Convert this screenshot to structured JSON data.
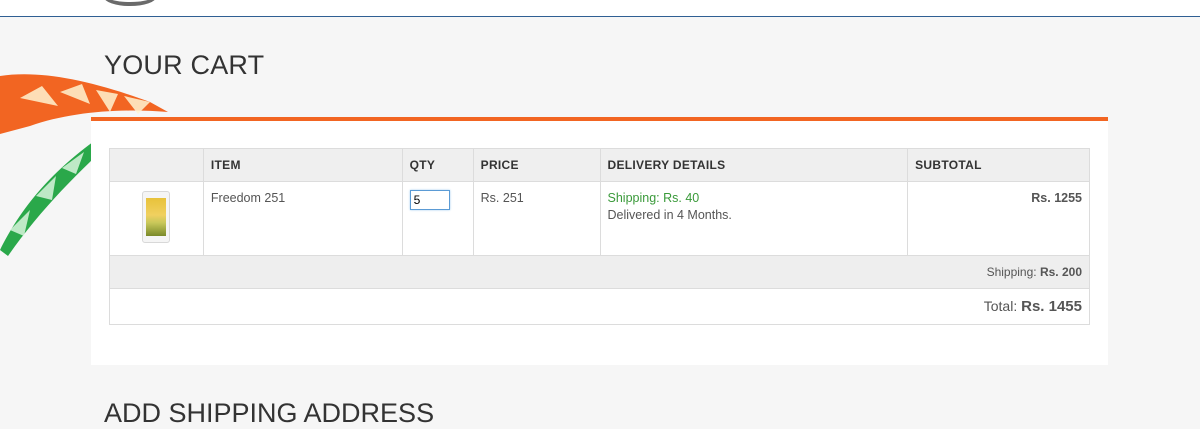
{
  "page": {
    "title": "YOUR CART",
    "next_section_title": "ADD SHIPPING ADDRESS"
  },
  "cart": {
    "columns": [
      "",
      "ITEM",
      "QTY",
      "PRICE",
      "DELIVERY DETAILS",
      "SUBTOTAL"
    ],
    "items": [
      {
        "image_icon": "phone-product-image",
        "name": "Freedom 251",
        "qty": "5",
        "price": "Rs. 251",
        "shipping": "Shipping: Rs. 40",
        "delivery": "Delivered in 4 Months.",
        "subtotal": "Rs. 1255"
      }
    ],
    "shipping_label": "Shipping:",
    "shipping_total": "Rs. 200",
    "total_label": "Total:",
    "total_value": "Rs. 1455"
  },
  "colors": {
    "accent_orange": "#f26522",
    "header_rule": "#2f5f93",
    "shipping_green": "#3a9a3a",
    "flag_saffron": "#f26522",
    "flag_green": "#2aa84a"
  }
}
